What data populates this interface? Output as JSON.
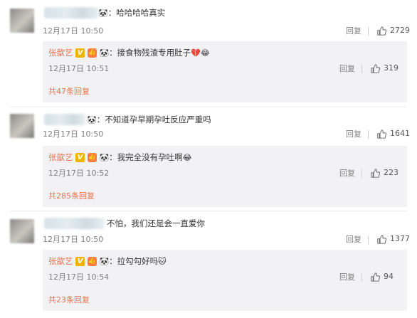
{
  "comments": [
    {
      "text": "：哈哈哈哈真实",
      "time": "12月17日 10:50",
      "reply_label": "回复",
      "likes": "2729",
      "reply": {
        "author": "张歆艺",
        "text": "：接食物残渣专用肚子",
        "emojis": [
          "💔",
          "😂"
        ],
        "time": "12月17日 10:51",
        "reply_label": "回复",
        "likes": "319"
      },
      "more_replies": "共47条回复"
    },
    {
      "text": "：不知道孕早期孕吐反应严重吗",
      "time": "12月17日 10:50",
      "reply_label": "回复",
      "likes": "1641",
      "reply": {
        "author": "张歆艺",
        "text": "：我完全没有孕吐啊",
        "emojis": [
          "😂"
        ],
        "time": "12月17日 10:52",
        "reply_label": "回复",
        "likes": "223"
      },
      "more_replies": "共285条回复"
    },
    {
      "text": "不怕，我们还是会一直爱你",
      "time": "12月17日 10:50",
      "reply_label": "回复",
      "likes": "1377",
      "reply": {
        "author": "张歆艺",
        "text": "：拉勾勾好吗",
        "emojis": [
          "🐱"
        ],
        "time": "12月17日 10:54",
        "reply_label": "回复",
        "likes": "94"
      },
      "more_replies": "共23条回复"
    }
  ],
  "icons": {
    "panda": "🐼",
    "verified": "V",
    "fan": "👍",
    "like": "thumbs-up-icon"
  },
  "colors": {
    "author_name": "#eb7350",
    "more_link": "#eb7350",
    "reply_box": "#f2f2f5",
    "meta_text": "#808080"
  }
}
